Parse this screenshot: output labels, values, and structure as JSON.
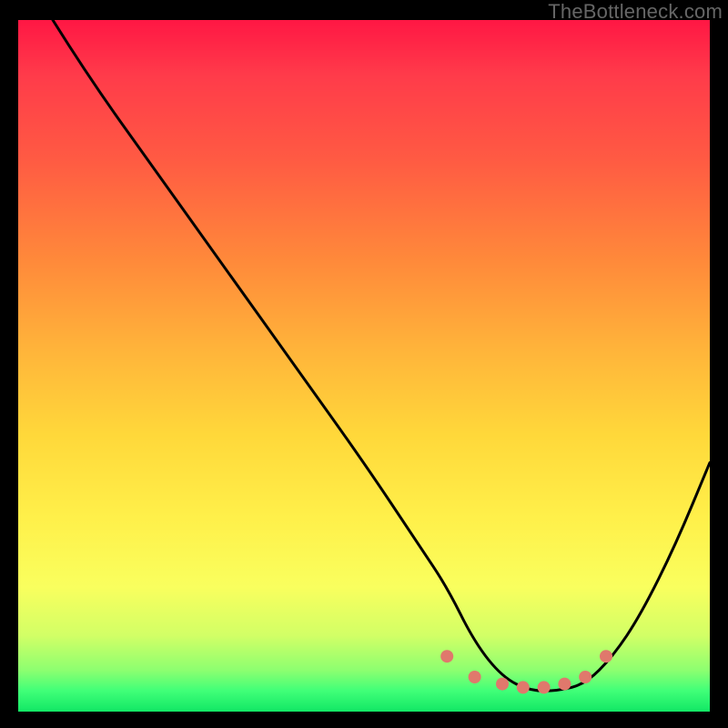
{
  "watermark": "TheBottleneck.com",
  "chart_data": {
    "type": "line",
    "title": "",
    "xlabel": "",
    "ylabel": "",
    "xlim": [
      0,
      100
    ],
    "ylim": [
      0,
      100
    ],
    "grid": false,
    "legend": false,
    "series": [
      {
        "name": "bottleneck-curve",
        "x": [
          5,
          10,
          20,
          30,
          40,
          50,
          58,
          62,
          66,
          70,
          74,
          78,
          82,
          86,
          90,
          95,
          100
        ],
        "y": [
          100,
          92,
          78,
          64,
          50,
          36,
          24,
          18,
          10,
          5,
          3,
          3,
          4,
          8,
          14,
          24,
          36
        ]
      }
    ],
    "markers": [
      {
        "name": "dot-left-edge",
        "x": 62,
        "y": 8,
        "color": "#e0786c"
      },
      {
        "name": "dot-1",
        "x": 66,
        "y": 5,
        "color": "#e0786c"
      },
      {
        "name": "dot-2",
        "x": 70,
        "y": 4,
        "color": "#e0786c"
      },
      {
        "name": "dot-3",
        "x": 73,
        "y": 3.5,
        "color": "#e0786c"
      },
      {
        "name": "dot-4",
        "x": 76,
        "y": 3.5,
        "color": "#e0786c"
      },
      {
        "name": "dot-5",
        "x": 79,
        "y": 4,
        "color": "#e0786c"
      },
      {
        "name": "dot-6",
        "x": 82,
        "y": 5,
        "color": "#e0786c"
      },
      {
        "name": "dot-right-edge",
        "x": 85,
        "y": 8,
        "color": "#e0786c"
      }
    ],
    "background_gradient": {
      "top": "#ff1744",
      "mid_upper": "#ff8a3a",
      "mid": "#ffd83a",
      "mid_lower": "#f9ff5e",
      "bottom": "#12e765"
    }
  }
}
